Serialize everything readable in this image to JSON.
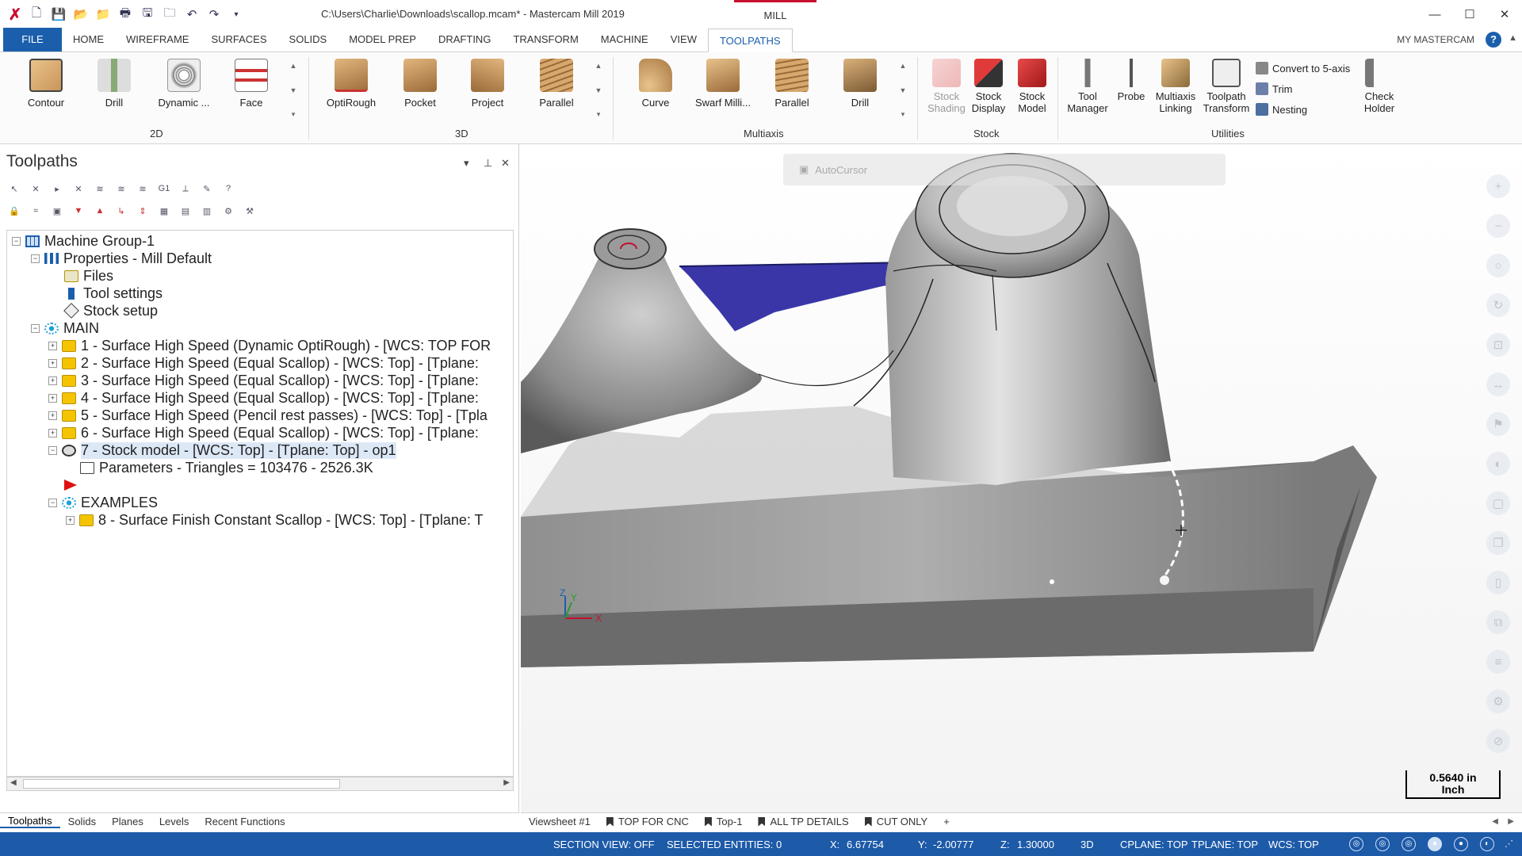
{
  "titlebar": {
    "title": "C:\\Users\\Charlie\\Downloads\\scallop.mcam* - Mastercam Mill 2019",
    "context_tab": "MILL"
  },
  "ribbon_tabs": [
    "FILE",
    "HOME",
    "WIREFRAME",
    "SURFACES",
    "SOLIDS",
    "MODEL PREP",
    "DRAFTING",
    "TRANSFORM",
    "MACHINE",
    "VIEW",
    "TOOLPATHS"
  ],
  "ribbon_active_tab": "TOOLPATHS",
  "my_mastercam": "MY MASTERCAM",
  "ribbon": {
    "groups": {
      "g2d": "2D",
      "g3d": "3D",
      "multiaxis": "Multiaxis",
      "stock": "Stock",
      "utilities": "Utilities"
    },
    "buttons_2d": [
      "Contour",
      "Drill",
      "Dynamic ...",
      "Face"
    ],
    "buttons_3d": [
      "OptiRough",
      "Pocket",
      "Project",
      "Parallel"
    ],
    "buttons_multiaxis": [
      "Curve",
      "Swarf Milli...",
      "Parallel",
      "Drill"
    ],
    "stock": {
      "shading": "Stock Shading",
      "display": "Stock Display",
      "model": "Stock Model"
    },
    "utilities": {
      "tool_manager": "Tool Manager",
      "probe": "Probe",
      "multiaxis_linking": "Multiaxis Linking",
      "toolpath_transform": "Toolpath Transform",
      "convert": "Convert to 5-axis",
      "trim": "Trim",
      "nesting": "Nesting",
      "check_holder": "Check Holder"
    }
  },
  "toolpaths_panel": {
    "title": "Toolpaths",
    "tree": {
      "machine_group": "Machine Group-1",
      "properties": "Properties - Mill Default",
      "files": "Files",
      "tool_settings": "Tool settings",
      "stock_setup": "Stock setup",
      "main": "MAIN",
      "ops": [
        "1 - Surface High Speed (Dynamic OptiRough) - [WCS: TOP FOR",
        "2 - Surface High Speed (Equal Scallop) - [WCS: Top] - [Tplane:",
        "3 - Surface High Speed (Equal Scallop) - [WCS: Top] - [Tplane:",
        "4 - Surface High Speed (Equal Scallop) - [WCS: Top] - [Tplane:",
        "5 - Surface High Speed (Pencil rest passes) - [WCS: Top] - [Tpla",
        "6 - Surface High Speed (Equal Scallop) - [WCS: Top] - [Tplane:"
      ],
      "stock_model": "7 - Stock model - [WCS: Top] - [Tplane: Top] - op1",
      "parameters": "Parameters - Triangles =  103476 - 2526.3K",
      "examples": "EXAMPLES",
      "example_op": "8 - Surface Finish Constant Scallop - [WCS: Top] - [Tplane: T"
    }
  },
  "bottom_tabs": [
    "Toolpaths",
    "Solids",
    "Planes",
    "Levels",
    "Recent Functions"
  ],
  "viewport": {
    "autocursor": "AutoCursor",
    "scale_value": "0.5640 in",
    "scale_unit": "Inch",
    "axis_x": "X",
    "axis_y": "Y",
    "axis_z": "Z"
  },
  "viewsheets": [
    "Viewsheet #1",
    "TOP FOR CNC",
    "Top-1",
    "ALL TP DETAILS",
    "CUT ONLY",
    "+"
  ],
  "status": {
    "section_view": "SECTION VIEW: OFF",
    "selected": "SELECTED ENTITIES: 0",
    "x_label": "X:",
    "x": "6.67754",
    "y_label": "Y:",
    "y": "-2.00777",
    "z_label": "Z:",
    "z": "1.30000",
    "mode": "3D",
    "cplane": "CPLANE: TOP",
    "tplane": "TPLANE: TOP",
    "wcs": "WCS: TOP"
  },
  "colors": {
    "accent": "#1b5fac",
    "brand": "#c8102e",
    "status_bar": "#1d5aa8"
  }
}
